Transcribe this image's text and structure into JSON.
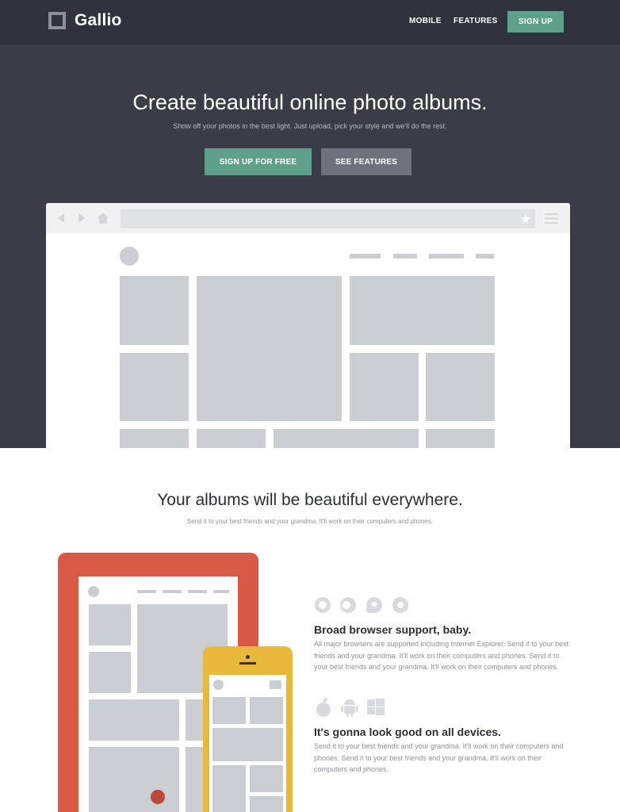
{
  "nav": {
    "brand": "Gallio",
    "links": [
      "MOBILE",
      "FEATURES"
    ],
    "signup_label": "SIGN UP"
  },
  "hero": {
    "title": "Create beautiful online photo albums.",
    "subtitle": "Show off your photos in the best light. Just upload, pick your style and we'll do the rest.",
    "cta_primary": "SIGN UP FOR FREE",
    "cta_secondary": "SEE FEATURES"
  },
  "features": {
    "title": "Your albums will be beautiful everywhere.",
    "subtitle": "Send it to your best friends and your grandma. It'll work on their computers and phones.",
    "items": [
      {
        "title": "Broad browser support, baby.",
        "text": "All major browsers are supported including Internet Explorer. Send it to your best friends and your grandma. It'll work on their computers and phones. Send it to your best friends and your grandma. It'll work on their computers and phones."
      },
      {
        "title": "It's gonna look good on all devices.",
        "text": "Send it to your best friends and your grandma. It'll work on their computers and phones. Send it to your best friends and your grandma. It'll work on their computers and phones."
      }
    ]
  },
  "colors": {
    "dark_bg": "#3a3d47",
    "nav_bg": "#31333c",
    "accent_green": "#5fa08a",
    "secondary_gray": "#6f717b",
    "tablet_red": "#d65a46",
    "phone_yellow": "#e8b83a",
    "placeholder_gray": "#cacdd2"
  },
  "icons": {
    "brand": "gallery-frame-icon",
    "browser_nav": [
      "back-arrow-icon",
      "forward-arrow-icon",
      "home-icon",
      "star-icon",
      "menu-icon"
    ],
    "browsers": [
      "chrome-icon",
      "firefox-icon",
      "internet-explorer-icon",
      "safari-icon"
    ],
    "platforms": [
      "apple-icon",
      "android-icon",
      "windows-icon"
    ]
  }
}
